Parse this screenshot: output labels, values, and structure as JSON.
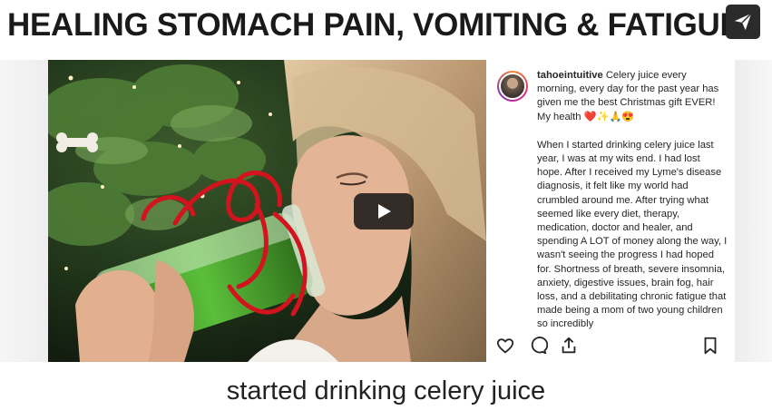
{
  "video": {
    "title": "HEALING STOMACH PAIN, VOMITING & FATIGUE",
    "subtitle": "started drinking celery juice"
  },
  "post": {
    "username": "tahoeintuitive",
    "caption_intro": "Celery juice every morning, every day for the past year has given me the best Christmas gift EVER! My health ❤️✨🙏😍",
    "caption_body": "When I started drinking celery juice last year, I was at my wits end. I had lost hope. After I received my Lyme's disease diagnosis, it felt like my world had crumbled around me. After trying what seemed like every diet, therapy, medication, doctor and healer, and spending A LOT of money along the way, I wasn't seeing the progress I had hoped for. Shortness of breath, severe insomnia, anxiety, digestive issues, brain fog, hair loss, and a debilitating chronic fatigue that made being a mom of two young children so incredibly"
  },
  "icons": {
    "share": "paper-plane-icon",
    "play": "play-icon",
    "like": "heart-icon",
    "comment": "comment-icon",
    "send": "upload-icon",
    "save": "bookmark-icon"
  },
  "colors": {
    "play_button_bg": "#141414",
    "juice_green": "#3f9a2a",
    "ribbon_red": "#d2141e"
  }
}
